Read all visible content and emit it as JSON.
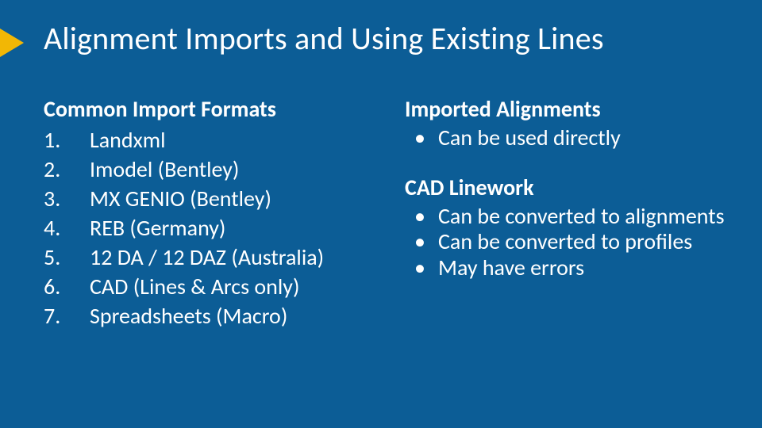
{
  "title": "Alignment Imports and Using Existing Lines",
  "left": {
    "heading": "Common Import Formats",
    "items": [
      "Landxml",
      "Imodel (Bentley)",
      "MX GENIO (Bentley)",
      "REB (Germany)",
      "12 DA / 12 DAZ (Australia)",
      "CAD (Lines & Arcs only)",
      "Spreadsheets (Macro)"
    ]
  },
  "right": {
    "section1": {
      "heading": "Imported Alignments",
      "bullets": [
        "Can be used directly"
      ]
    },
    "section2": {
      "heading": "CAD Linework",
      "bullets": [
        "Can be converted to alignments",
        "Can be converted to profiles",
        "May have errors"
      ]
    }
  }
}
